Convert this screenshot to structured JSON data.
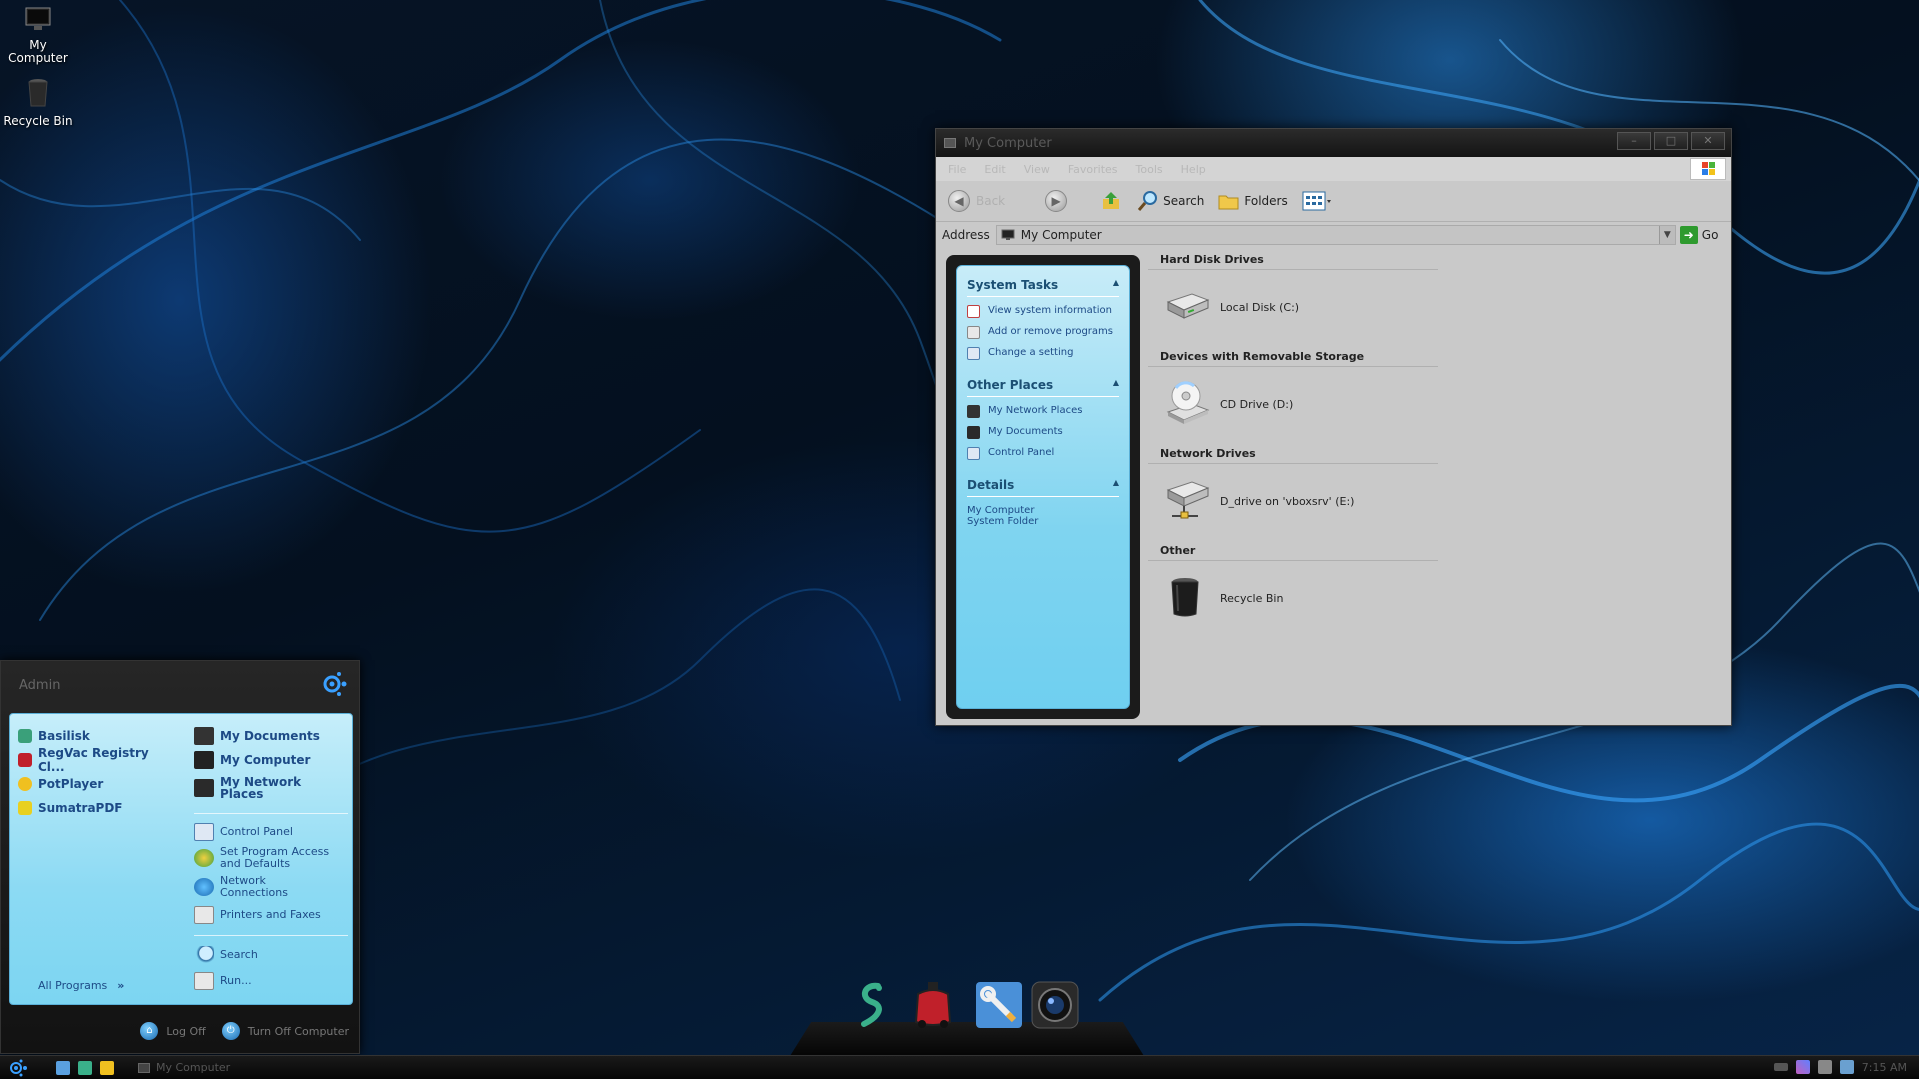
{
  "desktop": {
    "icons": [
      {
        "label_line1": "My",
        "label_line2": "Computer",
        "icon": "monitor-icon"
      },
      {
        "label_line1": "Recycle Bin",
        "label_line2": "",
        "icon": "recycle-bin-icon"
      }
    ]
  },
  "window": {
    "title": "My Computer",
    "controls": {
      "minimize": "–",
      "maximize": "□",
      "close": "✕"
    },
    "menu": [
      "File",
      "Edit",
      "View",
      "Favorites",
      "Tools",
      "Help"
    ],
    "toolbar": {
      "back": "Back",
      "search": "Search",
      "folders": "Folders"
    },
    "address": {
      "label": "Address",
      "value": "My Computer",
      "go": "Go"
    },
    "taskpane": {
      "system_tasks": {
        "title": "System Tasks",
        "items": [
          "View system information",
          "Add or remove programs",
          "Change a setting"
        ]
      },
      "other_places": {
        "title": "Other Places",
        "items": [
          "My Network Places",
          "My Documents",
          "Control Panel"
        ]
      },
      "details": {
        "title": "Details",
        "line1": "My Computer",
        "line2": "System Folder"
      }
    },
    "groups": [
      {
        "title": "Hard Disk Drives",
        "item": "Local Disk (C:)",
        "icon": "hard-disk-icon"
      },
      {
        "title": "Devices with Removable Storage",
        "item": "CD Drive (D:)",
        "icon": "cd-drive-icon"
      },
      {
        "title": "Network Drives",
        "item": "D_drive on 'vboxsrv' (E:)",
        "icon": "network-drive-icon"
      },
      {
        "title": "Other",
        "item": "Recycle Bin",
        "icon": "recycle-bin-icon"
      }
    ]
  },
  "startmenu": {
    "user": "Admin",
    "pinned": [
      {
        "label": "Basilisk",
        "color": "#3aa07a"
      },
      {
        "label": "RegVac Registry Cl...",
        "color": "#c0202a"
      },
      {
        "label": "PotPlayer",
        "color": "#f0c020"
      },
      {
        "label": "SumatraPDF",
        "color": "#e8d020"
      }
    ],
    "all_programs": "All Programs",
    "right": {
      "my_documents": "My Documents",
      "my_computer": "My Computer",
      "my_network_places_1": "My Network",
      "my_network_places_2": "Places",
      "control_panel": "Control Panel",
      "set_program_1": "Set Program Access",
      "set_program_2": "and Defaults",
      "network_connections_1": "Network",
      "network_connections_2": "Connections",
      "printers": "Printers and Faxes",
      "search": "Search",
      "run": "Run..."
    },
    "log_off": "Log Off",
    "turn_off": "Turn Off Computer"
  },
  "taskbar": {
    "task": "My Computer",
    "clock": "7:15 AM"
  }
}
